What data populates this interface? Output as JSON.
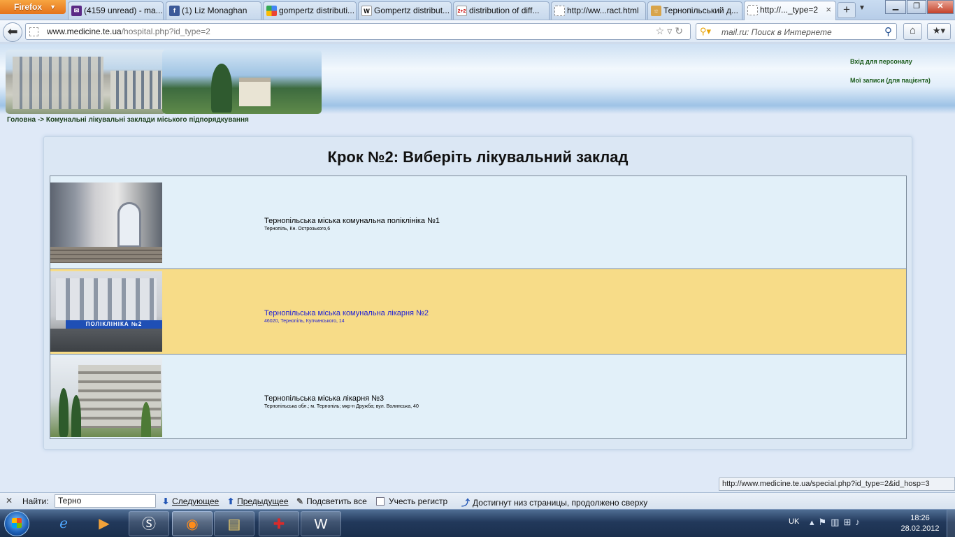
{
  "browser": {
    "app_button": "Firefox",
    "tabs": [
      {
        "label": "(4159 unread) - ma...",
        "favicon": "yahoo-mail-icon"
      },
      {
        "label": "(1) Liz Monaghan",
        "favicon": "facebook-icon"
      },
      {
        "label": "gompertz distributi...",
        "favicon": "google-icon"
      },
      {
        "label": "Gompertz distribut...",
        "favicon": "wikipedia-icon"
      },
      {
        "label": "distribution of diff...",
        "favicon": "math-icon"
      },
      {
        "label": "http://ww...ract.html",
        "favicon": "blank-page-icon"
      },
      {
        "label": "Тернопільський д...",
        "favicon": "site-icon"
      },
      {
        "label": "http://..._type=2",
        "favicon": "blank-page-icon"
      }
    ],
    "url_domain": "www.medicine.te.ua",
    "url_path": "/hospital.php?id_type=2",
    "search_placeholder": "mail.ru: Поиск в Интернете"
  },
  "site": {
    "header_links": [
      "Вхід для персоналу",
      "Мої записи (для пацієнта)"
    ],
    "breadcrumb": "Головна -> Комунальні лікувальні заклади міського підпорядкування",
    "step_title": "Крок №2: Виберіть лікувальний заклад",
    "hospitals": [
      {
        "name": "Тернопільська міська комунальна поліклініка №1",
        "address": "Тернопіль, Кн. Острозького,6"
      },
      {
        "name": "Тернопільська міська комунальна лікарня №2",
        "address": "46020, Тернопіль, Купчинського, 14",
        "photo_sign": "ПОЛІКЛІНІКА №2"
      },
      {
        "name": "Тернопільська міська лікарня №3",
        "address": "Тернопільська обл.; м. Тернопіль; мкр-н Дружба; вул. Волинська, 40"
      }
    ],
    "highlight_color": "#f7dc88"
  },
  "status_url": "http://www.medicine.te.ua/special.php?id_type=2&id_hosp=3",
  "findbar": {
    "label": "Найти:",
    "query": "Терно",
    "next": "Следующее",
    "prev": "Предыдущее",
    "highlight_all": "Подсветить все",
    "match_case": "Учесть регистр",
    "message": "Достигнут низ страницы, продолжено сверху"
  },
  "taskbar": {
    "apps": [
      "ie-icon",
      "media-player-icon",
      "skype-icon",
      "firefox-icon",
      "explorer-icon",
      "app-icon",
      "word-icon"
    ],
    "language": "UK",
    "time": "18:26",
    "date": "28.02.2012"
  }
}
